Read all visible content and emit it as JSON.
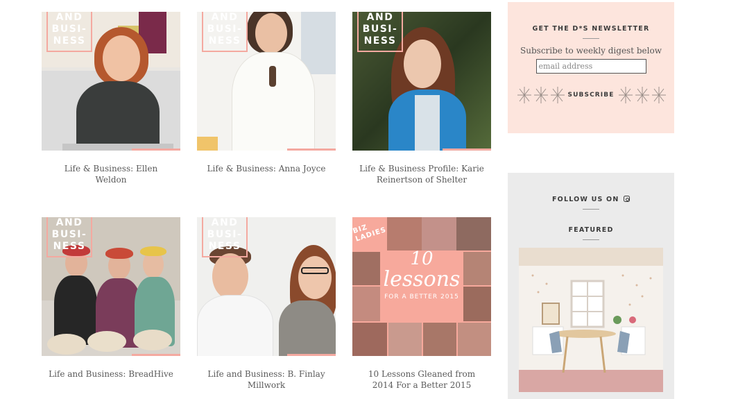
{
  "badge_lines": [
    "AND",
    "BUSI-",
    "NESS"
  ],
  "posts": [
    {
      "title": "Life & Business: Ellen Weldon"
    },
    {
      "title": "Life & Business: Anna Joyce"
    },
    {
      "title": "Life & Business Profile: Karie Reinertson of Shelter"
    },
    {
      "title": "Life and Business: BreadHive"
    },
    {
      "title": "Life and Business: B. Finlay Millwork"
    },
    {
      "title": "10 Lessons Gleaned from 2014 For a Better 2015"
    }
  ],
  "lessons_art": {
    "tag1": "BIZ",
    "tag2": "LADIES",
    "big1": "10",
    "big2": "lessons",
    "sub": "FOR A BETTER 2015"
  },
  "newsletter": {
    "heading": "GET THE D*S NEWSLETTER",
    "subtitle": "Subscribe to weekly digest below",
    "placeholder": "email address",
    "button": "SUBSCRIBE"
  },
  "follow": {
    "heading": "FOLLOW US ON",
    "featured": "FEATURED"
  },
  "colors": {
    "pink_accent": "#f4a9a0",
    "newsletter_bg": "#fde5dd",
    "sidebar_bg": "#ebebeb",
    "text": "#5a5a5a"
  }
}
